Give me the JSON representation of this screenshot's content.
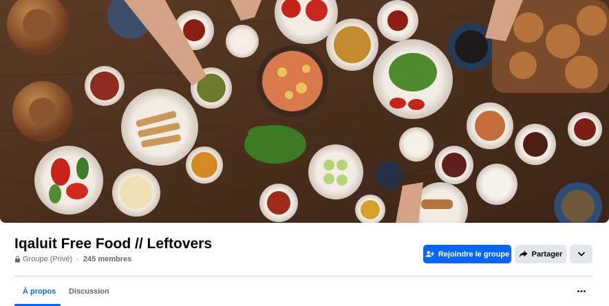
{
  "cover": {
    "description_icon": "cover-photo-food-spread"
  },
  "group": {
    "name": "Iqaluit Free Food // Leftovers",
    "privacy": "Groupe (Privé)",
    "separator": " · ",
    "members": "245 membres"
  },
  "actions": {
    "join_label": "Rejoindre le groupe",
    "join_icon": "group-join-icon",
    "share_label": "Partager",
    "share_icon": "share-arrow-icon",
    "more_icon": "chevron-down-icon"
  },
  "tabs": [
    {
      "label": "À propos",
      "active": true
    },
    {
      "label": "Discussion",
      "active": false
    }
  ],
  "tabs_more_icon": "ellipsis-icon",
  "colors": {
    "accent": "#0866ff",
    "secondary_button": "#e4e6eb",
    "muted_text": "#65676b"
  }
}
